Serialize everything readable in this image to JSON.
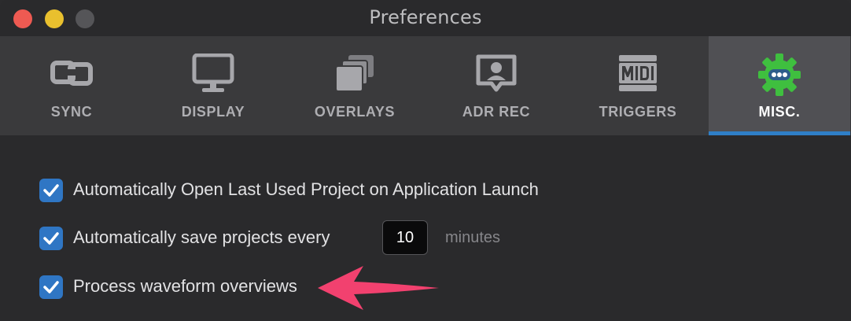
{
  "window": {
    "title": "Preferences"
  },
  "tabs": [
    {
      "label": "SYNC",
      "icon": "sync-icon",
      "active": false
    },
    {
      "label": "DISPLAY",
      "icon": "monitor-icon",
      "active": false
    },
    {
      "label": "OVERLAYS",
      "icon": "overlays-icon",
      "active": false
    },
    {
      "label": "ADR REC",
      "icon": "adr-rec-icon",
      "active": false
    },
    {
      "label": "TRIGGERS",
      "icon": "midi-icon",
      "active": false
    },
    {
      "label": "MISC.",
      "icon": "gear-icon",
      "active": true
    }
  ],
  "options": {
    "open_last_project": {
      "label": "Automatically Open Last Used Project on Application Launch",
      "checked": true
    },
    "autosave": {
      "label": "Automatically save projects every",
      "checked": true,
      "value": "10",
      "unit": "minutes"
    },
    "waveform": {
      "label": "Process waveform overviews",
      "checked": true
    }
  },
  "colors": {
    "accent": "#2f76c4",
    "gear_green": "#3fbf3f",
    "annotation_arrow": "#f2416f",
    "traffic_close": "#ee5a52",
    "traffic_min": "#e9c02e"
  }
}
